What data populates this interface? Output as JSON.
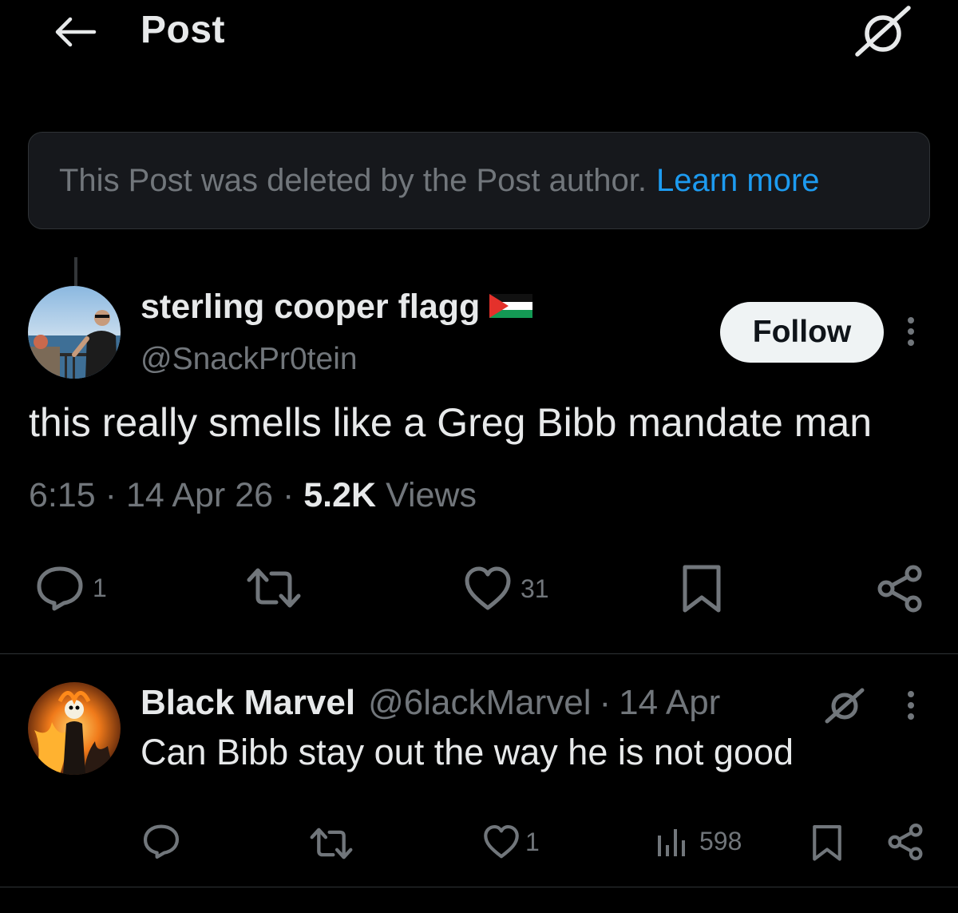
{
  "header": {
    "title": "Post"
  },
  "notice": {
    "text": "This Post was deleted by the Post author.",
    "link": "Learn more"
  },
  "post": {
    "display_name": "sterling cooper flagg",
    "handle": "@SnackPr0tein",
    "follow_label": "Follow",
    "text": "this really smells like a Greg Bibb mandate man",
    "time": "6:15",
    "date": "14 Apr 26",
    "views_count": "5.2K",
    "views_label": "Views",
    "reply_count": "1",
    "like_count": "31"
  },
  "reply": {
    "display_name": "Black Marvel",
    "handle": "@6lackMarvel",
    "date": "14 Apr",
    "text": "Can Bibb stay out the way he is not good",
    "like_count": "1",
    "views_count": "598"
  },
  "colors": {
    "background": "#000000",
    "primary_text": "#e7e9ea",
    "secondary_text": "#71767b",
    "accent": "#1d9bf0",
    "notice_bg": "#16181c",
    "divider": "#2f3336"
  }
}
